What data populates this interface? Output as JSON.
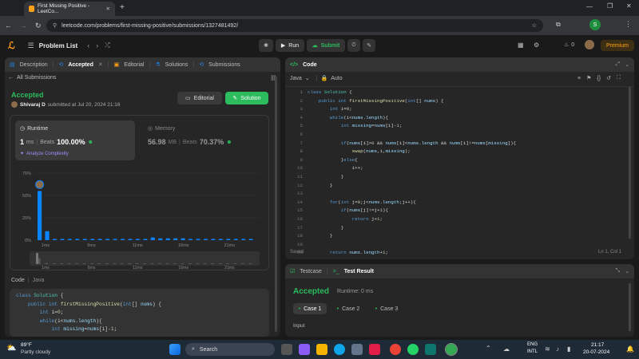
{
  "browser": {
    "tab_title": "First Missing Positive - LeetCo...",
    "url": "leetcode.com/problems/first-missing-positive/submissions/1327481492/"
  },
  "header": {
    "problem_list": "Problem List",
    "run": "Run",
    "submit": "Submit",
    "streak": "0",
    "premium": "Premium"
  },
  "left_tabs": [
    "Description",
    "Accepted",
    "Editorial",
    "Solutions",
    "Submissions"
  ],
  "submission": {
    "back": "All Submissions",
    "status": "Accepted",
    "user": "Shivaraj D",
    "submitted": "submitted at Jul 20, 2024 21:16",
    "editorial_btn": "Editorial",
    "solution_btn": "Solution"
  },
  "runtime": {
    "label": "Runtime",
    "value": "1",
    "unit": "ms",
    "beats_label": "Beats",
    "beats": "100.00%",
    "analyze": "Analyze Complexity"
  },
  "memory": {
    "label": "Memory",
    "value": "56.98",
    "unit": "MB",
    "beats_label": "Beats",
    "beats": "70.37%"
  },
  "chart_data": {
    "type": "bar",
    "y_ticks": [
      "75%",
      "50%",
      "25%",
      "0%"
    ],
    "ylim": [
      0,
      75
    ],
    "x_ticks": [
      "1ms",
      "6ms",
      "11ms",
      "16ms",
      "21ms"
    ],
    "range_ticks": [
      "1ms",
      "6ms",
      "11ms",
      "16ms",
      "21ms"
    ],
    "values": [
      55,
      10,
      1,
      1,
      1,
      1,
      1,
      1,
      1,
      1,
      1,
      1,
      1,
      1,
      1,
      3,
      2,
      2,
      2,
      2,
      1,
      1,
      1,
      1,
      1,
      1,
      1,
      1,
      1
    ],
    "highlight_index": 0,
    "bar_color": "#0a84ff"
  },
  "code_section": {
    "label": "Code",
    "lang": "Java",
    "lines": [
      "class Solution {",
      "    public int firstMissingPositive(int[] nums) {",
      "        int i=0;",
      "        while(i<nums.length){",
      "            int missing=nums[i]-1;"
    ]
  },
  "editor": {
    "title": "Code",
    "lang": "Java",
    "auto": "Auto",
    "saved": "Saved",
    "cursor": "Ln 1, Col 1",
    "line_numbers": [
      "1",
      "2",
      "3",
      "4",
      "5",
      "6",
      "7",
      "8",
      "9",
      "10",
      "11",
      "12",
      "13",
      "14",
      "15",
      "16",
      "17",
      "18",
      "19",
      "20",
      "21"
    ],
    "lines": [
      "class Solution {",
      "    public int firstMissingPositive(int[] nums) {",
      "        int i=0;",
      "        while(i<nums.length){",
      "            int missing=nums[i]-1;",
      "",
      "            if(nums[i]>0 && nums[i]<nums.length && nums[i]!=nums[missing]){",
      "                swap(nums,i,missing);",
      "            }else{",
      "                i++;",
      "            }",
      "        }",
      "",
      "        for(int j=0;j<nums.length;j++){",
      "            if(nums[j]!=j+1){",
      "                return j+1;",
      "            }",
      "        }",
      "",
      "        return nums.length+1;",
      ""
    ]
  },
  "testpanel": {
    "tab1": "Testcase",
    "tab2": "Test Result",
    "status": "Accepted",
    "runtime": "Runtime: 0 ms",
    "cases": [
      "Case 1",
      "Case 2",
      "Case 3"
    ],
    "input_label": "Input"
  },
  "taskbar": {
    "temp": "89°F",
    "weather": "Partly cloudy",
    "search": "Search",
    "lang1": "ENG",
    "lang2": "INTL",
    "time": "21:17",
    "date": "20-07-2024"
  }
}
